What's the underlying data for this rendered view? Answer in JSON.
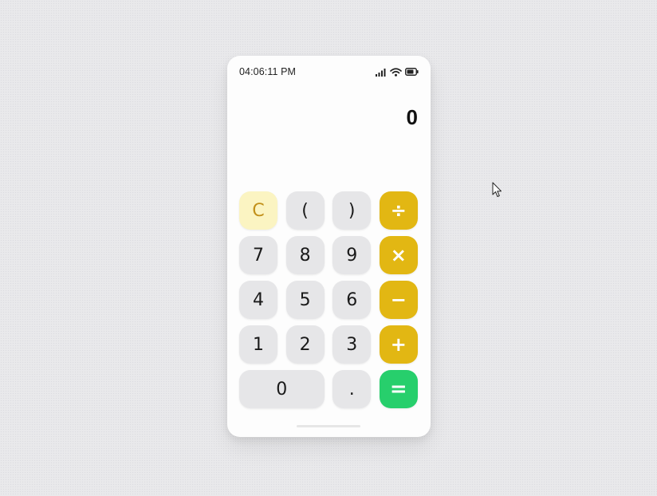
{
  "status_bar": {
    "time": "04:06:11 PM",
    "icons": [
      "signal-icon",
      "wifi-icon",
      "battery-icon"
    ]
  },
  "display": {
    "value": "0"
  },
  "keys": {
    "clear": "C",
    "paren_open": "(",
    "paren_close": ")",
    "divide": "÷",
    "seven": "7",
    "eight": "8",
    "nine": "9",
    "multiply": "×",
    "four": "4",
    "five": "5",
    "six": "6",
    "minus": "−",
    "one": "1",
    "two": "2",
    "three": "3",
    "plus": "+",
    "zero": "0",
    "decimal": ".",
    "equals": "="
  },
  "colors": {
    "operator": "#e2b713",
    "equals": "#27cf6c",
    "clear_bg": "#fbf4c2",
    "clear_text": "#c2901a",
    "key_bg": "#e6e6e8"
  }
}
